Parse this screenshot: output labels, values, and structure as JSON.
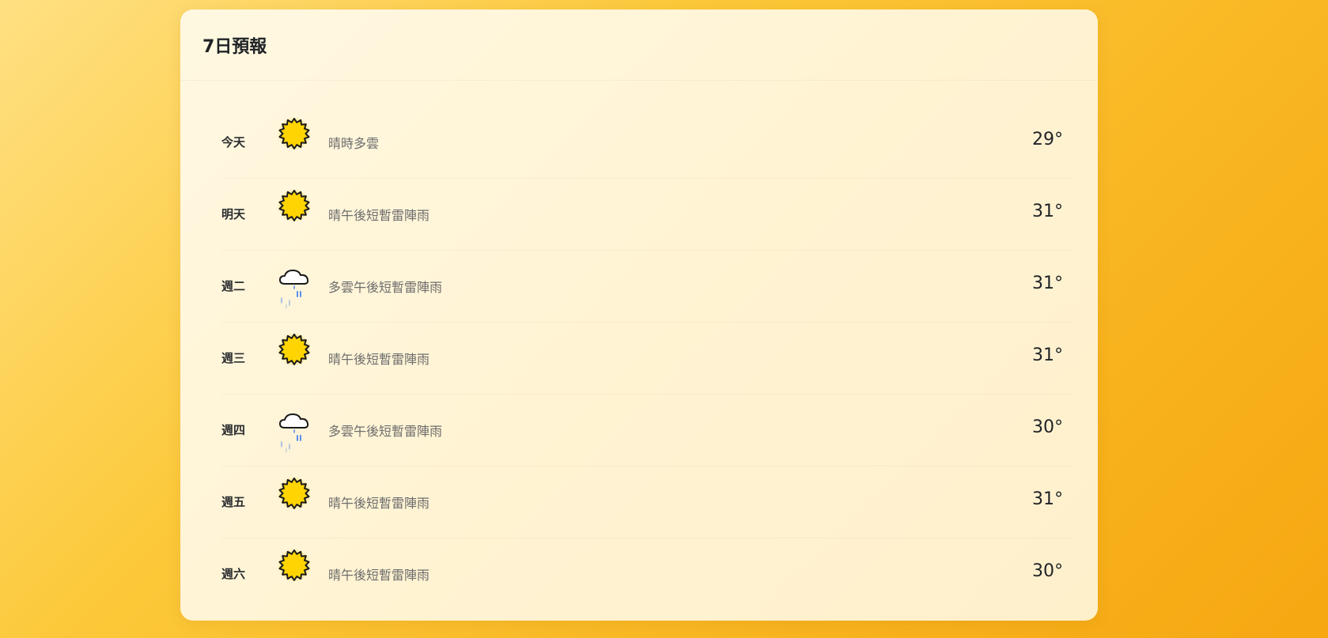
{
  "forecast": {
    "title": "7日預報",
    "days": [
      {
        "day": "今天",
        "icon": "sun-icon",
        "desc": "晴時多雲",
        "temp": "29°"
      },
      {
        "day": "明天",
        "icon": "sun-icon",
        "desc": "晴午後短暫雷陣雨",
        "temp": "31°"
      },
      {
        "day": "週二",
        "icon": "cloud-rain-icon",
        "desc": "多雲午後短暫雷陣雨",
        "temp": "31°"
      },
      {
        "day": "週三",
        "icon": "sun-icon",
        "desc": "晴午後短暫雷陣雨",
        "temp": "31°"
      },
      {
        "day": "週四",
        "icon": "cloud-rain-icon",
        "desc": "多雲午後短暫雷陣雨",
        "temp": "30°"
      },
      {
        "day": "週五",
        "icon": "sun-icon",
        "desc": "晴午後短暫雷陣雨",
        "temp": "31°"
      },
      {
        "day": "週六",
        "icon": "sun-icon",
        "desc": "晴午後短暫雷陣雨",
        "temp": "30°"
      }
    ]
  },
  "colors": {
    "sun_fill": "#ffd400",
    "sun_stroke": "#1a1a1a",
    "rain": "#5b8def"
  }
}
